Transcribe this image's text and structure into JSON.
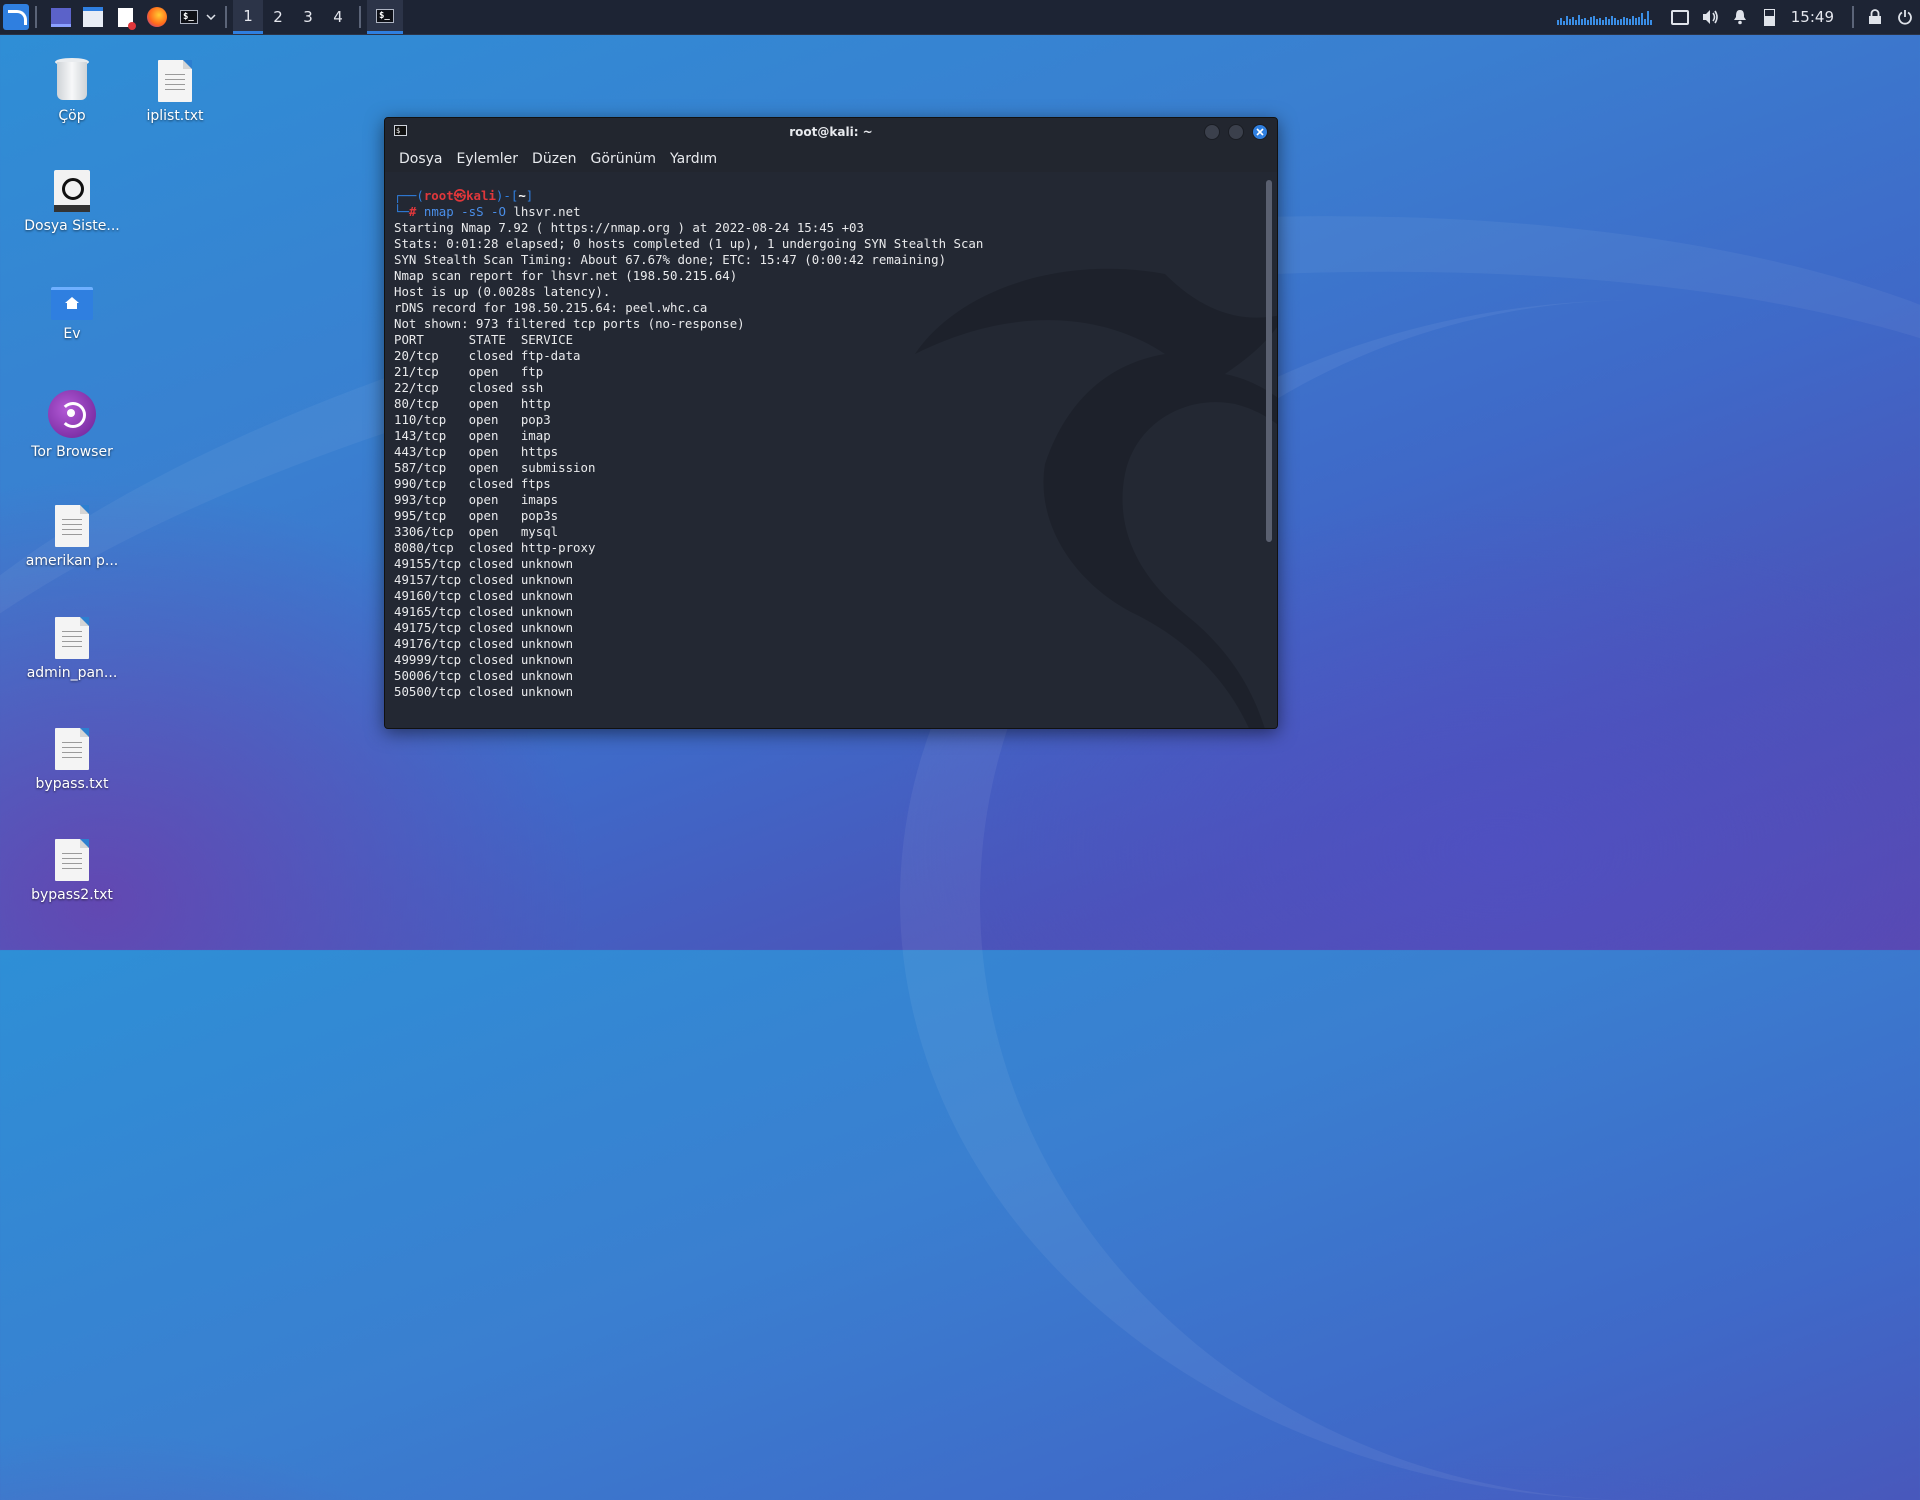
{
  "taskbar": {
    "workspaces": [
      "1",
      "2",
      "3",
      "4"
    ],
    "clock": "15:49",
    "icons": [
      "kali-menu-icon",
      "show-desktop-icon",
      "file-manager-icon",
      "text-editor-icon",
      "firefox-icon",
      "terminal-icon",
      "chevron-down-icon",
      "display-icon",
      "volume-icon",
      "notification-bell-icon",
      "battery-icon",
      "lock-icon",
      "power-icon"
    ]
  },
  "desktop": {
    "icons": [
      {
        "label": "Çöp",
        "icon": "trash-icon"
      },
      {
        "label": "iplist.txt",
        "icon": "text-file-icon"
      },
      {
        "label": "Dosya Siste...",
        "icon": "drive-icon"
      },
      {
        "label": "Ev",
        "icon": "home-folder-icon"
      },
      {
        "label": "Tor Browser",
        "icon": "tor-browser-icon"
      },
      {
        "label": "amerikan p...",
        "icon": "text-file-icon"
      },
      {
        "label": "admin_pan...",
        "icon": "text-file-icon"
      },
      {
        "label": "bypass.txt",
        "icon": "text-file-icon"
      },
      {
        "label": "bypass2.txt",
        "icon": "text-file-icon"
      }
    ]
  },
  "terminal": {
    "title": "root@kali: ~",
    "menu": [
      "Dosya",
      "Eylemler",
      "Düzen",
      "Görünüm",
      "Yardım"
    ],
    "prompt": {
      "open": "┌──(",
      "user": "root㉿kali",
      "mid": ")-[",
      "dir": "~",
      "close": "]",
      "line2": "└─",
      "hash": "#",
      "command": "nmap -sS -O",
      "arg": "lhsvr.net"
    },
    "output": "Starting Nmap 7.92 ( https://nmap.org ) at 2022-08-24 15:45 +03\nStats: 0:01:28 elapsed; 0 hosts completed (1 up), 1 undergoing SYN Stealth Scan\nSYN Stealth Scan Timing: About 67.67% done; ETC: 15:47 (0:00:42 remaining)\nNmap scan report for lhsvr.net (198.50.215.64)\nHost is up (0.0028s latency).\nrDNS record for 198.50.215.64: peel.whc.ca\nNot shown: 973 filtered tcp ports (no-response)\nPORT      STATE  SERVICE\n20/tcp    closed ftp-data\n21/tcp    open   ftp\n22/tcp    closed ssh\n80/tcp    open   http\n110/tcp   open   pop3\n143/tcp   open   imap\n443/tcp   open   https\n587/tcp   open   submission\n990/tcp   closed ftps\n993/tcp   open   imaps\n995/tcp   open   pop3s\n3306/tcp  open   mysql\n8080/tcp  closed http-proxy\n49155/tcp closed unknown\n49157/tcp closed unknown\n49160/tcp closed unknown\n49165/tcp closed unknown\n49175/tcp closed unknown\n49176/tcp closed unknown\n49999/tcp closed unknown\n50006/tcp closed unknown\n50500/tcp closed unknown"
  }
}
